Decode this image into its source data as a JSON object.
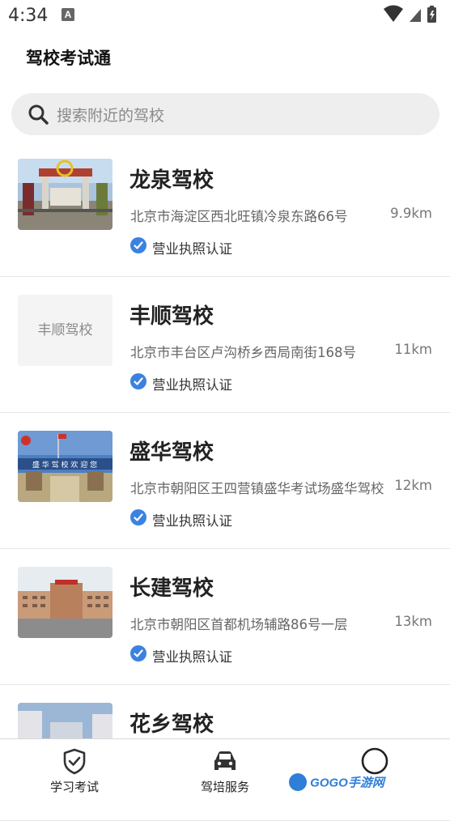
{
  "status_bar": {
    "time": "4:34",
    "notification_icon": "A"
  },
  "app": {
    "title": "驾校考试通"
  },
  "search": {
    "placeholder": "搜索附近的驾校"
  },
  "schools": [
    {
      "name": "龙泉驾校",
      "address": "北京市海淀区西北旺镇冷泉东路66号",
      "distance": "9.9km",
      "certification": "营业执照认证",
      "thumbnail": "photo"
    },
    {
      "name": "丰顺驾校",
      "address": "北京市丰台区卢沟桥乡西局南街168号",
      "distance": "11km",
      "certification": "营业执照认证",
      "thumbnail": "text",
      "thumbnail_text": "丰顺驾校"
    },
    {
      "name": "盛华驾校",
      "address": "北京市朝阳区王四营镇盛华考试场盛华驾校",
      "distance": "12km",
      "certification": "营业执照认证",
      "thumbnail": "photo",
      "thumbnail_banner": "盛 华 驾 校 欢 迎 您"
    },
    {
      "name": "长建驾校",
      "address": "北京市朝阳区首都机场辅路86号一层",
      "distance": "13km",
      "certification": "营业执照认证",
      "thumbnail": "photo"
    },
    {
      "name": "花乡驾校",
      "thumbnail": "photo"
    }
  ],
  "bottom_nav": [
    {
      "label": "学习考试",
      "icon": "shield-check-icon"
    },
    {
      "label": "驾培服务",
      "icon": "car-icon"
    },
    {
      "label": "",
      "icon": "circle-icon"
    }
  ],
  "watermark": {
    "text": "GOGO手游网"
  },
  "colors": {
    "accent": "#3b82e0",
    "text": "#222222",
    "muted": "#666666",
    "search_bg": "#eeeeee"
  }
}
